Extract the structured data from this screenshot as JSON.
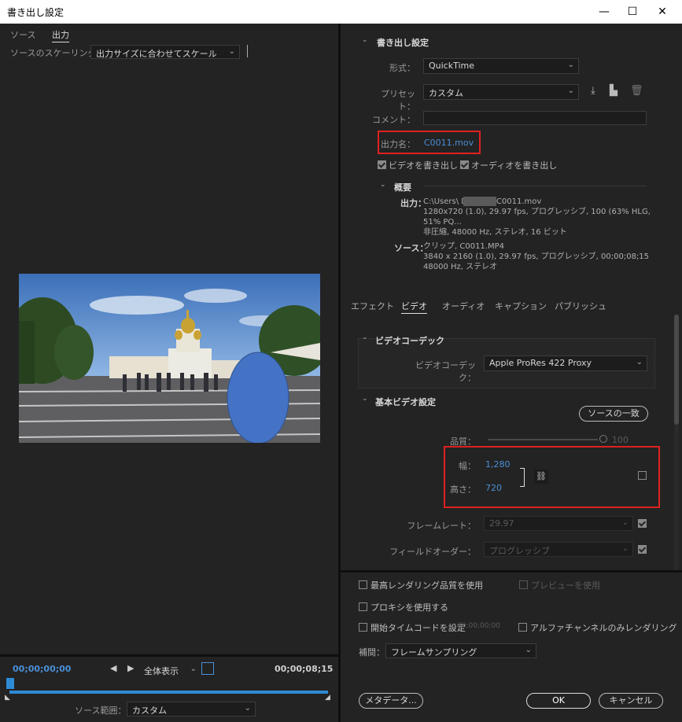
{
  "window": {
    "title": "書き出し設定",
    "minimize": "—",
    "maximize": "☐",
    "close": "✕"
  },
  "left": {
    "tabs": [
      "ソース",
      "出力"
    ],
    "scaling_label": "ソースのスケーリング：",
    "scaling_value": "出力サイズに合わせてスケール",
    "timecode_start": "00;00;00;00",
    "timecode_end": "00;00;08;15",
    "zoom_value": "全体表示",
    "source_range_label": "ソース範囲：",
    "source_range_value": "カスタム"
  },
  "export": {
    "section_title": "書き出し設定",
    "format_label": "形式：",
    "format_value": "QuickTime",
    "preset_label": "プリセット：",
    "preset_value": "カスタム",
    "comment_label": "コメント：",
    "comment_value": "",
    "output_name_label": "出力名：",
    "output_name_value": "C0011.mov",
    "export_video_label": "ビデオを書き出し",
    "export_audio_label": "オーディオを書き出し",
    "summary_title": "概要",
    "output_label": "出力：",
    "output_lines": [
      "C:\\Users\\      Desktop\\C0011.mov",
      "1280x720 (1.0), 29.97 fps, プログレッシブ, 100 (63% HLG, 51% PQ...",
      "非圧縮, 48000 Hz, ステレオ, 16 ビット"
    ],
    "source_label": "ソース：",
    "source_lines": [
      "クリップ, C0011.MP4",
      "3840 x 2160 (1.0), 29.97 fps, プログレッシブ, 00;00;08;15",
      "48000 Hz, ステレオ"
    ]
  },
  "right_tabs": [
    "エフェクト",
    "ビデオ",
    "オーディオ",
    "キャプション",
    "パブリッシュ"
  ],
  "video": {
    "codec_section": "ビデオコーデック",
    "codec_label": "ビデオコーデック：",
    "codec_value": "Apple ProRes 422 Proxy",
    "basic_section": "基本ビデオ設定",
    "match_source": "ソースの一致",
    "quality_label": "品質：",
    "quality_value": "100",
    "width_label": "幅：",
    "width_value": "1,280",
    "height_label": "高さ：",
    "height_value": "720",
    "frame_rate_label": "フレームレート：",
    "frame_rate_value": "29.97",
    "field_order_label": "フィールドオーダー：",
    "field_order_value": "プログレッシブ"
  },
  "bottom": {
    "max_render": "最高レンダリング品質を使用",
    "use_preview": "プレビューを使用",
    "use_proxy": "プロキシを使用する",
    "set_timecode": "開始タイムコードを設定",
    "timecode_value": "00;00;00;00",
    "alpha_only": "アルファチャンネルのみレンダリング",
    "interp_label": "補間：",
    "interp_value": "フレームサンプリング",
    "metadata_btn": "メタデータ...",
    "ok_btn": "OK",
    "cancel_btn": "キャンセル"
  }
}
